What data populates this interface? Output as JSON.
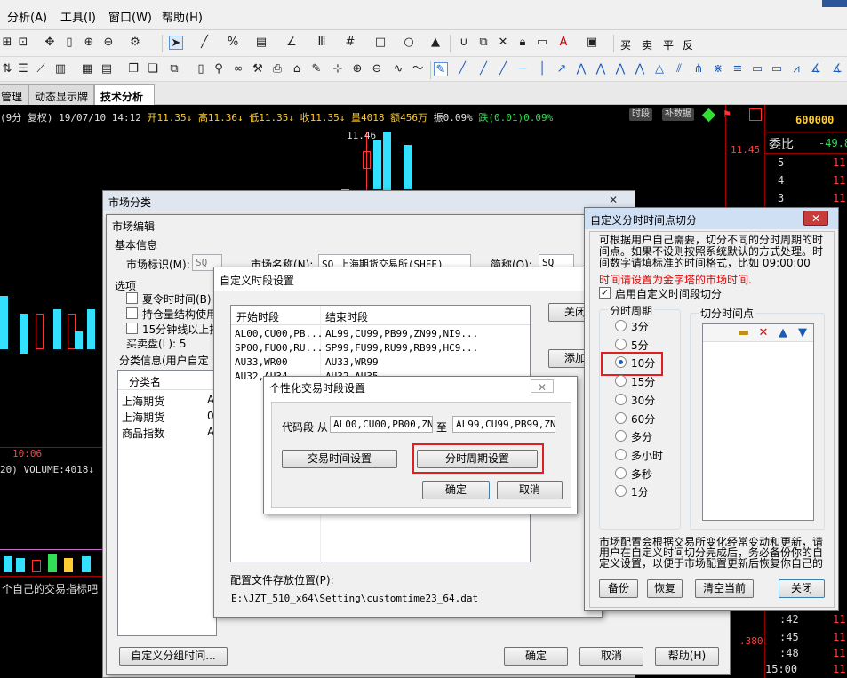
{
  "menu": {
    "items": [
      "分析(A)",
      "工具(I)",
      "窗口(W)",
      "帮助(H)"
    ]
  },
  "toolbar2": {
    "buy": "买",
    "sell": "卖",
    "flat": "平",
    "reverse": "反"
  },
  "tabs": {
    "items": [
      "管理",
      "动态显示牌",
      "技术分析"
    ]
  },
  "chart": {
    "info_prefix": "(9分 复权) 19/07/10 14:12",
    "open": "开11.35↓",
    "high": "高11.36↓",
    "low": "低11.35↓",
    "close": "收11.35↓",
    "vol": "量4018",
    "amount": "额456万",
    "amp": "振0.09%",
    "chg": "跌(0.01)0.09%",
    "btn_period": "时段",
    "btn_data": "补数据",
    "price_top": "11.46",
    "price_right": "11.45",
    "time_label": "10:06",
    "volume_line": "20) VOLUME:4018↓",
    "bottom_text": "个自己的交易指标吧",
    "right_value": ".380"
  },
  "right_panel": {
    "code": "600000",
    "weibi_label": "委比",
    "weibi_value": "-49.8",
    "rows": [
      {
        "n": "5",
        "v": "11"
      },
      {
        "n": "4",
        "v": "11"
      },
      {
        "n": "3",
        "v": "11"
      }
    ],
    "bottom_rows": [
      {
        "t": ":42",
        "v": "11"
      },
      {
        "t": ":45",
        "v": "11"
      },
      {
        "t": ":48",
        "v": "11"
      },
      {
        "t": "15:00",
        "v": "11"
      }
    ]
  },
  "market_class": {
    "title": "市场分类"
  },
  "market_edit": {
    "title": "市场编辑",
    "basic_info": "基本信息",
    "market_id_label": "市场标识(M):",
    "market_id": "SQ",
    "market_name_label": "市场名称(N):",
    "market_name": "SQ 上海期货交易所(SHFE)",
    "short_label": "简称(O):",
    "short_name": "SQ",
    "options_label": "选项",
    "opt_dst": "夏令时时间(B)",
    "opt_pos": "持仓量结构使用",
    "opt_15": "15分钟线以上按",
    "buysell_label": "买卖盘(L): 5",
    "class_info": "分类信息(用户自定",
    "class_header": "分类名",
    "class_rows": [
      {
        "name": "上海期货",
        "v": "A"
      },
      {
        "name": "上海期货",
        "v": "0"
      },
      {
        "name": "商品指数",
        "v": "A"
      }
    ],
    "custom_group_btn": "自定义分组时间...",
    "ok_btn": "确定",
    "cancel_btn": "取消",
    "help_btn": "帮助(H)"
  },
  "custom_period": {
    "title": "自定义时段设置",
    "col_start": "开始时段",
    "col_end": "结束时段",
    "rows": [
      {
        "start": "AL00,CU00,PB...",
        "end": "AL99,CU99,PB99,ZN99,NI9..."
      },
      {
        "start": "SP00,FU00,RU...",
        "end": "SP99,FU99,RU99,RB99,HC9..."
      },
      {
        "start": "AU33,WR00",
        "end": "AU33,WR99"
      },
      {
        "start": "AU32,AU34",
        "end": "AU32,AU35"
      }
    ],
    "btn_close": "关闭",
    "btn_add": "添加",
    "config_label": "配置文件存放位置(P):",
    "config_path": "E:\\JZT_510_x64\\Setting\\customtime23_64.dat"
  },
  "personal": {
    "title": "个性化交易时段设置",
    "code_label": "代码段 从",
    "code_from": "AL00,CU00,PB00,ZN0",
    "to_label": "至",
    "code_to": "AL99,CU99,PB99,ZN9",
    "btn_trade_time": "交易时间设置",
    "btn_tick": "分时周期设置",
    "ok": "确定",
    "cancel": "取消"
  },
  "cut_dialog": {
    "title": "自定义分时时间点切分",
    "desc": "可根据用户自己需要，切分不同的分时周期的时间点。如果不设则按照系统默认的方式处理。时间数字请填标准的时间格式，比如 09:00:00",
    "warn": "时间请设置为金字塔的市场时间.",
    "enable_label": "启用自定义时间段切分",
    "period_group": "分时周期",
    "cut_group": "切分时间点",
    "periods": [
      "3分",
      "5分",
      "10分",
      "15分",
      "30分",
      "60分",
      "多分",
      "多小时",
      "多秒",
      "1分"
    ],
    "selected": "10分",
    "footer_text": "市场配置会根据交易所变化经常变动和更新，请用户在自定义时间切分完成后，务必备份你的自定义设置，以便于市场配置更新后恢复你自己的",
    "btn_backup": "备份",
    "btn_restore": "恢复",
    "btn_clear": "清空当前",
    "btn_close": "关闭"
  }
}
